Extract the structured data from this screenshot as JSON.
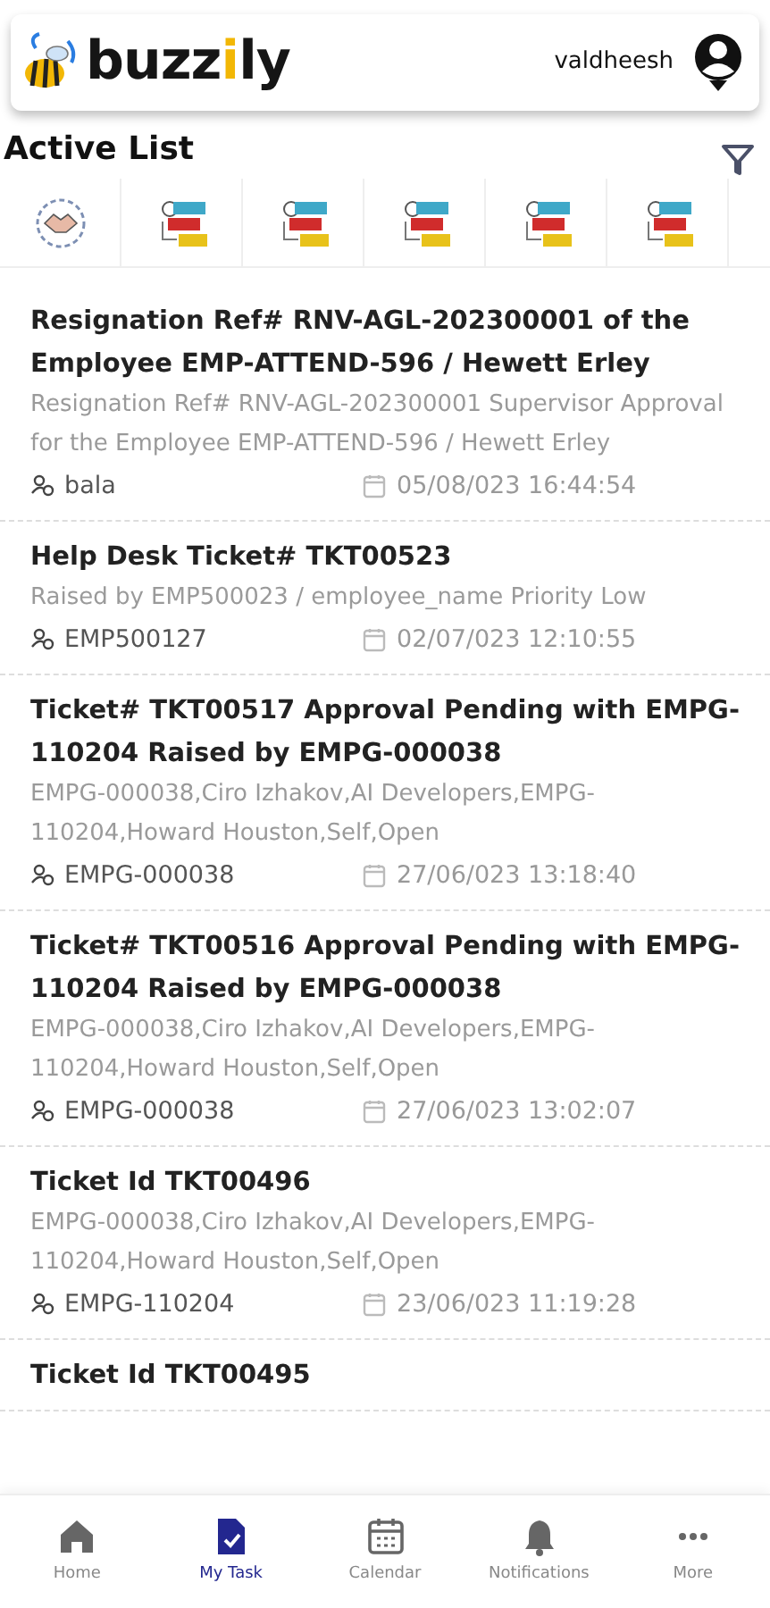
{
  "header": {
    "logo": [
      {
        "text": "buzz",
        "color": "#151515"
      },
      {
        "text": "i",
        "color": "#f2b705"
      },
      {
        "text": "ly",
        "color": "#151515"
      }
    ],
    "username": "valdheesh"
  },
  "section_title": "Active List",
  "categories": [
    {
      "kind": "handshake"
    },
    {
      "kind": "ticket"
    },
    {
      "kind": "ticket"
    },
    {
      "kind": "ticket"
    },
    {
      "kind": "ticket"
    },
    {
      "kind": "ticket"
    }
  ],
  "tasks": [
    {
      "title": "Resignation Ref# RNV-AGL-202300001 of the Employee EMP-ATTEND-596 / Hewett Erley",
      "description": "Resignation Ref# RNV-AGL-202300001 Supervisor Approval for the Employee EMP-ATTEND-596 / Hewett Erley",
      "assignee": "bala",
      "datetime": "05/08/023 16:44:54"
    },
    {
      "title": "Help Desk Ticket# TKT00523",
      "description": "Raised by EMP500023 / employee_name Priority Low",
      "assignee": "EMP500127",
      "datetime": "02/07/023 12:10:55"
    },
    {
      "title": "Ticket# TKT00517 Approval Pending with EMPG-110204 Raised by EMPG-000038",
      "description": "EMPG-000038,Ciro Izhakov,AI Developers,EMPG-110204,Howard Houston,Self,Open",
      "assignee": "EMPG-000038",
      "datetime": "27/06/023 13:18:40"
    },
    {
      "title": "Ticket# TKT00516 Approval Pending with EMPG-110204 Raised by EMPG-000038",
      "description": "EMPG-000038,Ciro Izhakov,AI Developers,EMPG-110204,Howard Houston,Self,Open",
      "assignee": "EMPG-000038",
      "datetime": "27/06/023 13:02:07"
    },
    {
      "title": "Ticket Id TKT00496",
      "description": "EMPG-000038,Ciro Izhakov,AI Developers,EMPG-110204,Howard Houston,Self,Open",
      "assignee": "EMPG-110204",
      "datetime": "23/06/023 11:19:28"
    },
    {
      "title": "Ticket Id TKT00495"
    }
  ],
  "bottom_nav": [
    {
      "kind": "home",
      "label": "Home",
      "selected": false
    },
    {
      "kind": "task",
      "label": "My Task",
      "selected": true
    },
    {
      "kind": "calendar",
      "label": "Calendar",
      "selected": false
    },
    {
      "kind": "bell",
      "label": "Notifications",
      "selected": false
    },
    {
      "kind": "more",
      "label": "More",
      "selected": false
    }
  ]
}
